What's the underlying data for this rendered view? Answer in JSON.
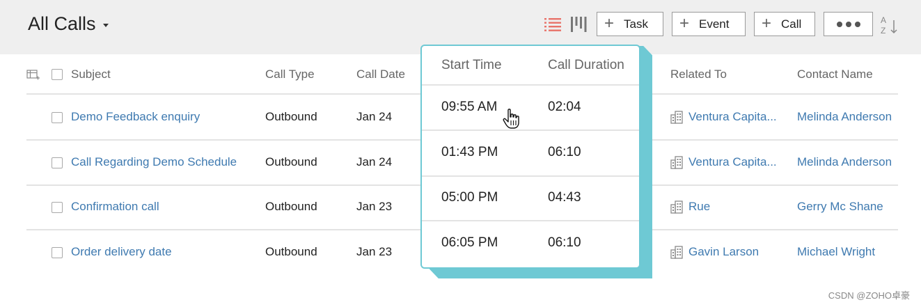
{
  "header": {
    "title": "All Calls",
    "buttons": {
      "task": "Task",
      "event": "Event",
      "call": "Call"
    },
    "icons": [
      "list-view-icon",
      "kanban-view-icon",
      "more-icon",
      "sort-az-icon"
    ],
    "accent_color": "#e8736a"
  },
  "table": {
    "columns": {
      "subject": "Subject",
      "call_type": "Call Type",
      "call_date": "Call Date",
      "related_to": "Related To",
      "contact_name": "Contact Name"
    },
    "rows": [
      {
        "subject": "Demo Feedback enquiry",
        "call_type": "Outbound",
        "call_date": "Jan 24",
        "related_to": "Ventura Capita...",
        "contact_name": "Melinda Anderson"
      },
      {
        "subject": "Call Regarding Demo Schedule",
        "call_type": "Outbound",
        "call_date": "Jan 24",
        "related_to": "Ventura Capita...",
        "contact_name": "Melinda Anderson"
      },
      {
        "subject": "Confirmation call",
        "call_type": "Outbound",
        "call_date": "Jan 23",
        "related_to": "Rue",
        "contact_name": "Gerry Mc Shane"
      },
      {
        "subject": "Order delivery date",
        "call_type": "Outbound",
        "call_date": "Jan 23",
        "related_to": "Gavin Larson",
        "contact_name": "Michael Wright"
      }
    ]
  },
  "popover": {
    "columns": {
      "start_time": "Start Time",
      "call_duration": "Call Duration"
    },
    "rows": [
      {
        "start_time": "09:55 AM",
        "call_duration": "02:04"
      },
      {
        "start_time": "01:43 PM",
        "call_duration": "06:10"
      },
      {
        "start_time": "05:00 PM",
        "call_duration": "04:43"
      },
      {
        "start_time": "06:05 PM",
        "call_duration": "06:10"
      }
    ],
    "border_color": "#6ec9d4"
  },
  "watermark": "CSDN @ZOHO卓豪"
}
